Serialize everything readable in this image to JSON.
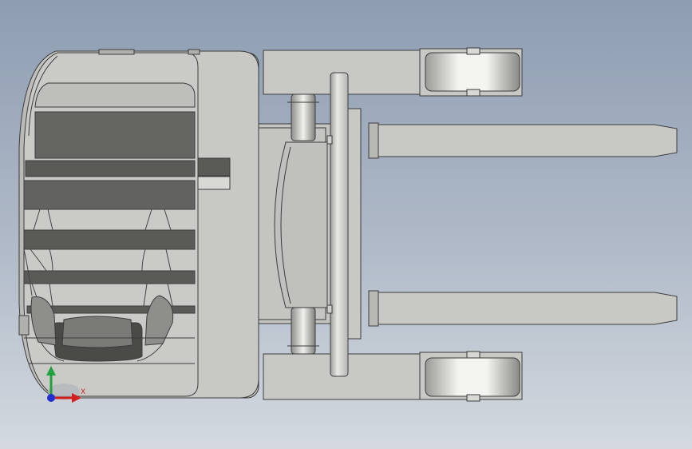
{
  "viewport": {
    "background_top": "#8e9db2",
    "background_bottom": "#d4d9e0"
  },
  "model": {
    "subject": "forklift-top-view",
    "body_color": "#c8c8c4",
    "line_color": "#3c3c3c",
    "dark_band_color": "#5a5a56",
    "wheel_color": "#e8e8e4"
  },
  "triad": {
    "x_label": "X",
    "y_label": "",
    "x_color": "#d02020",
    "y_color": "#20a040",
    "z_color": "#2030d0"
  }
}
